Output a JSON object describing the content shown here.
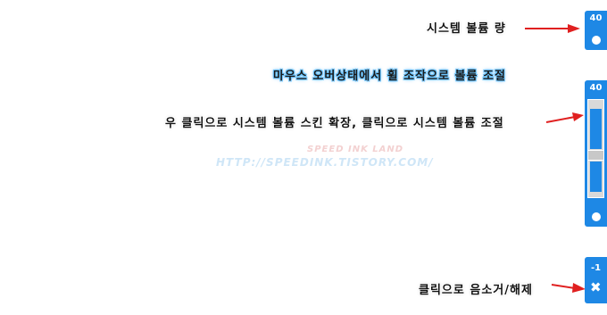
{
  "annotations": {
    "volume": "시스템 볼륨 량",
    "wheel": "마우스 오버상태에서 휠 조작으로 볼륨 조절",
    "right_click": "우 클릭으로 시스템 볼륨 스킨 확장, 클릭으로 시스템 볼륨 조절",
    "mute": "클릭으로 음소거/해제"
  },
  "watermark": {
    "site_name": "SPEED INK LAND",
    "url": "HTTP://SPEEDINK.TISTORY.COM/"
  },
  "widgets": {
    "compact": {
      "value": "40"
    },
    "expanded": {
      "value": "40",
      "level_percent": 40
    },
    "muted": {
      "value": "-1"
    }
  },
  "colors": {
    "accent": "#1e88e5",
    "arrow": "#e02020",
    "track": "#d9d9d9"
  },
  "icons": {
    "indicator": "circle-dot-icon",
    "mute": "close-x-icon"
  }
}
